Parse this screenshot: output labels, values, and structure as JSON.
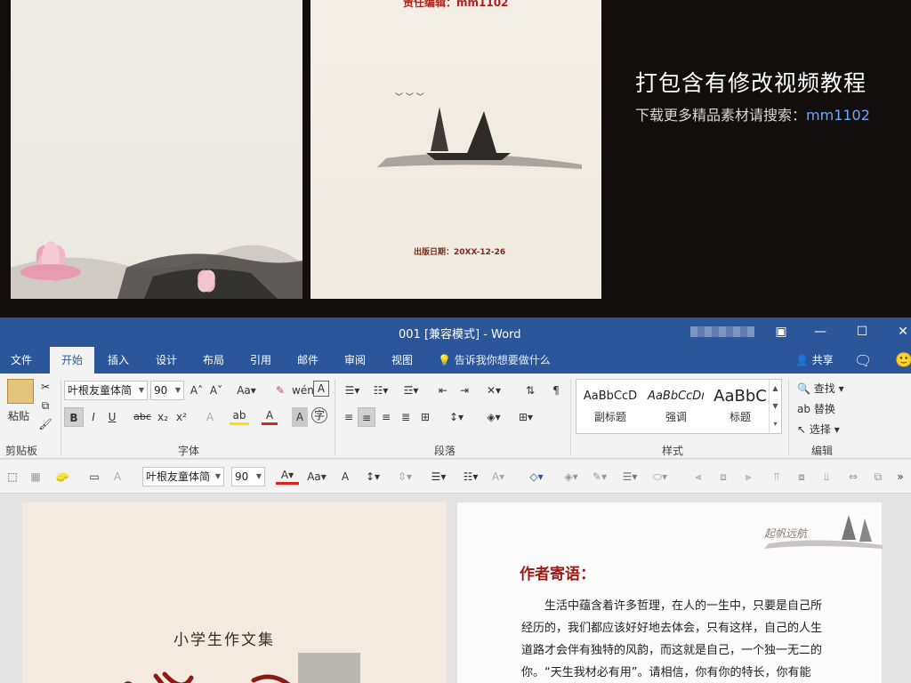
{
  "promo": {
    "title": "打包含有修改视频教程",
    "subtitle_prefix": "下载更多精品素材请搜索：",
    "subtitle_highlight": "mm1102"
  },
  "preview": {
    "editor_line": "责任编辑：mm1102",
    "publish_date": "出版日期：20XX-12-26"
  },
  "window": {
    "title": "001 [兼容模式]  -  Word"
  },
  "tabs": [
    {
      "label": "文件"
    },
    {
      "label": "开始"
    },
    {
      "label": "插入"
    },
    {
      "label": "设计"
    },
    {
      "label": "布局"
    },
    {
      "label": "引用"
    },
    {
      "label": "邮件"
    },
    {
      "label": "审阅"
    },
    {
      "label": "视图"
    }
  ],
  "tell_me": "告诉我你想要做什么",
  "share": "共享",
  "ribbon": {
    "paste_label": "粘贴",
    "clipboard_label": "剪贴板",
    "font_name": "叶根友童体简",
    "font_size": "90",
    "font_label": "字体",
    "paragraph_label": "段落",
    "styles_label": "样式",
    "editing_label": "编辑",
    "aa_label": "Aa",
    "bold": "B",
    "italic": "I",
    "underline": "U",
    "strike": "abc",
    "styles": [
      {
        "sample": "AaBbCcD",
        "name": "副标题"
      },
      {
        "sample": "AaBbCcDı",
        "name": "强调"
      },
      {
        "sample": "AaBbC",
        "name": "标题"
      }
    ],
    "find": "查找",
    "replace": "替换",
    "select": "选择"
  },
  "minitoolbar": {
    "font_name": "叶根友童体简",
    "font_size": "90",
    "aa_label": "Aa"
  },
  "doc": {
    "cover_subtitle": "小学生作文集",
    "author_heading": "作者寄语：",
    "signature": "起帆远航",
    "body_lines": [
      "生活中蕴含着许多哲理，在人的一生中，只要是自己所",
      "经历的，我们都应该好好地去体会，只有这样，自己的人生",
      "道路才会伴有独特的风韵，而这就是自己，一个独一无二的",
      "你。“天生我材必有用”。请相信，你有你的特长，你有能"
    ]
  },
  "colors": {
    "word_blue": "#2b579a",
    "heading_red": "#9b1b15",
    "highlight_blue": "#6ea8ff"
  }
}
